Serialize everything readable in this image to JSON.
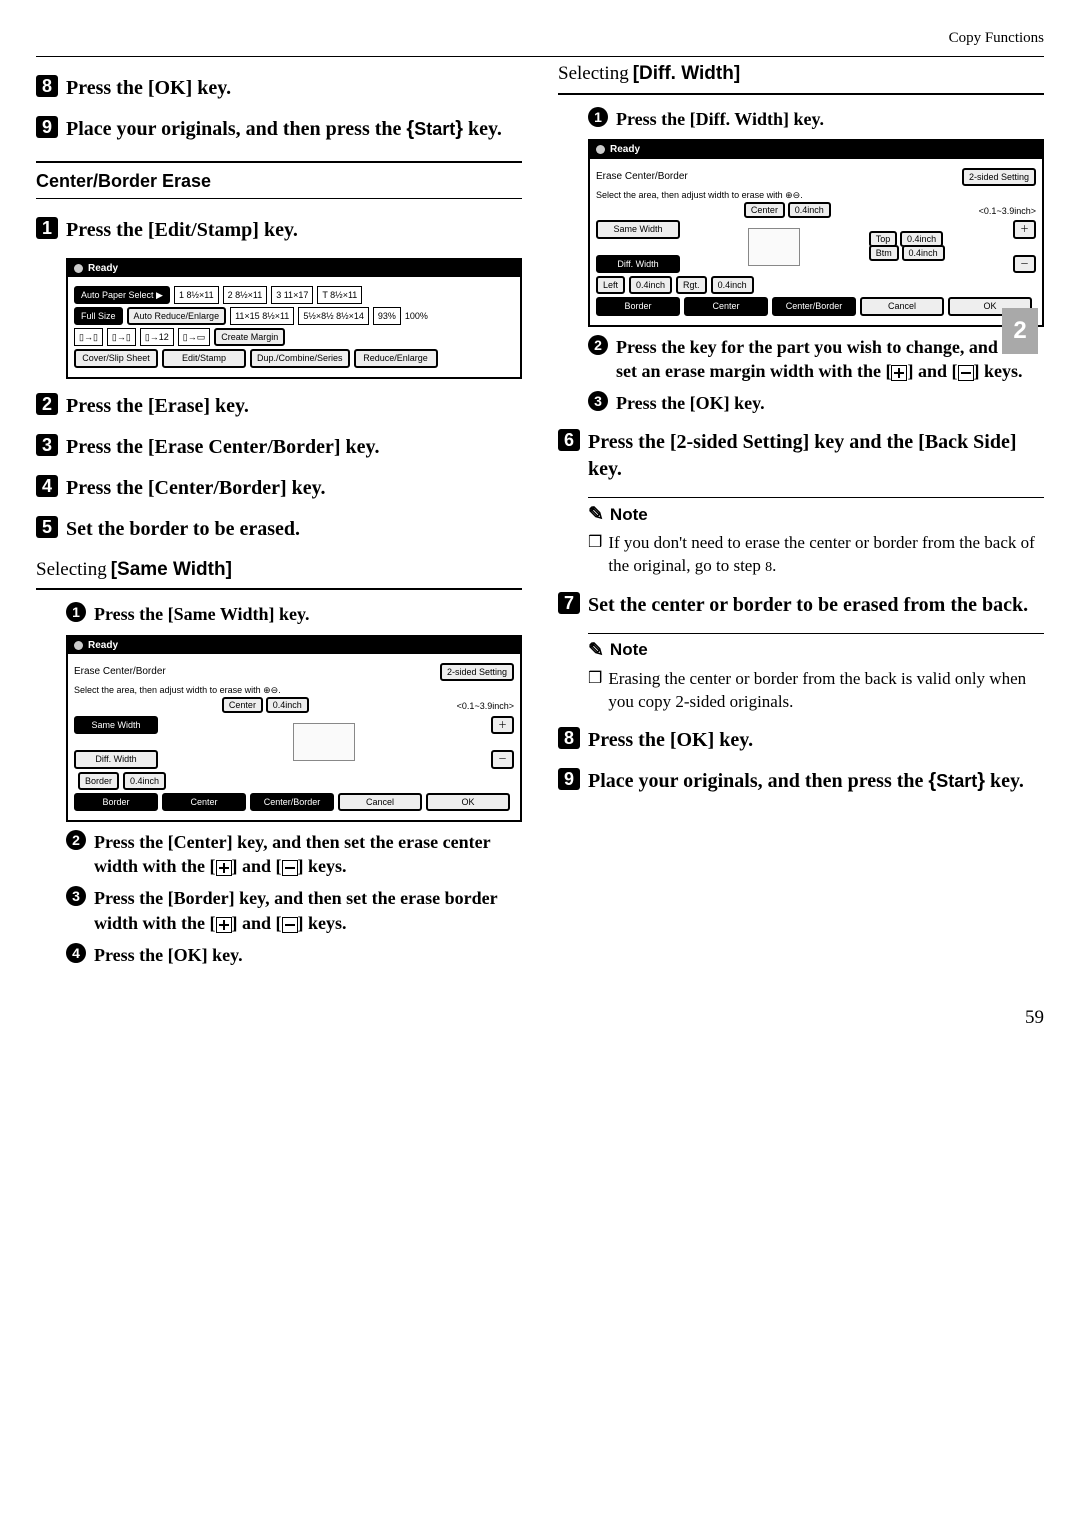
{
  "header": {
    "section": "Copy Functions"
  },
  "side_tab": "2",
  "page_number": "59",
  "left": {
    "steps_top": {
      "s8": "Press the [OK] key.",
      "s9": {
        "a": "Place your originals, and then press the ",
        "start": "Start",
        "b": " key."
      }
    },
    "center_border_erase": {
      "title": "Center/Border Erase",
      "s1": "Press the [Edit/Stamp] key.",
      "s2": "Press the [Erase] key.",
      "s3": "Press the [Erase Center/Border] key.",
      "s4": "Press the [Center/Border] key.",
      "s5": "Set the border to be erased."
    },
    "screenshot1": {
      "ready": "Ready",
      "auto_paper": "Auto Paper\nSelect ▶",
      "p1": "1\n8½×11",
      "p2": "2\n8½×11",
      "p3": "3\n11×17",
      "p4": "T\n8½×11",
      "full_size": "Full Size",
      "auto_re": "Auto Reduce/Enlarge",
      "r1": "11×15\n8½×11",
      "r2": "5½×8½\n8½×14",
      "pct": "93%",
      "hund": "100%",
      "create": "Create\nMargin",
      "bot1": "Cover/Slip Sheet",
      "bot2": "Edit/Stamp",
      "bot3": "Dup./Combine/Series",
      "bot4": "Reduce/Enlarge"
    },
    "same_width": {
      "title_pre": "Selecting ",
      "title_key": "[Same Width]",
      "c1": "Press the [Same Width] key.",
      "c2": {
        "a": "Press the [Center] key, and then set the erase center width with the [",
        "b": "] and [",
        "c": "] keys."
      },
      "c3": {
        "a": "Press the [Border] key, and then set the erase border width with the [",
        "b": "] and [",
        "c": "] keys."
      },
      "c4": "Press the [OK] key."
    },
    "screenshot2": {
      "ready": "Ready",
      "title": "Erase Center/Border",
      "btn_2sided": "2-sided Setting",
      "instr": "Select the area, then adjust width to erase with ⊕⊖.",
      "center": "Center",
      "center_v": "0.4inch",
      "range": "<0.1~3.9inch>",
      "same_w": "Same Width",
      "diff_w": "Diff. Width",
      "border": "Border",
      "border_v": "0.4inch",
      "b_border": "Border",
      "b_center": "Center",
      "b_cb": "Center/Border",
      "b_cancel": "Cancel",
      "b_ok": "OK",
      "plus": "＋",
      "minus": "－"
    }
  },
  "right": {
    "diff_width": {
      "title_pre": "Selecting ",
      "title_key": "[Diff. Width]",
      "c1": "Press the [Diff. Width] key.",
      "c2": {
        "a": "Press the key for the part you wish to change, and then set an erase margin width with the [",
        "b": "] and [",
        "c": "] keys."
      },
      "c3": "Press the [OK] key."
    },
    "screenshot3": {
      "ready": "Ready",
      "title": "Erase Center/Border",
      "btn_2sided": "2-sided Setting",
      "instr": "Select the area, then adjust width to erase with ⊕⊖.",
      "center": "Center",
      "center_v": "0.4inch",
      "range": "<0.1~3.9inch>",
      "same_w": "Same Width",
      "diff_w": "Diff. Width",
      "top": "Top",
      "top_v": "0.4inch",
      "btm": "Btm",
      "btm_v": "0.4inch",
      "left": "Left",
      "left_v": "0.4inch",
      "rgt": "Rgt.",
      "rgt_v": "0.4inch",
      "b_border": "Border",
      "b_center": "Center",
      "b_cb": "Center/Border",
      "b_cancel": "Cancel",
      "b_ok": "OK",
      "plus": "＋",
      "minus": "－"
    },
    "s6": "Press the [2-sided Setting] key and the [Back Side] key.",
    "note1_head": "Note",
    "note1_body": {
      "a": "If you don't need to erase the center or border from the back of the original, go to step ",
      "b": "."
    },
    "note1_step": "8",
    "s7": "Set the center or border to be erased from the back.",
    "note2_head": "Note",
    "note2_body": "Erasing the center or border from the back is valid only when you copy 2-sided originals.",
    "s8": "Press the [OK] key.",
    "s9": {
      "a": "Place your originals, and then press the ",
      "start": "Start",
      "b": " key."
    }
  }
}
